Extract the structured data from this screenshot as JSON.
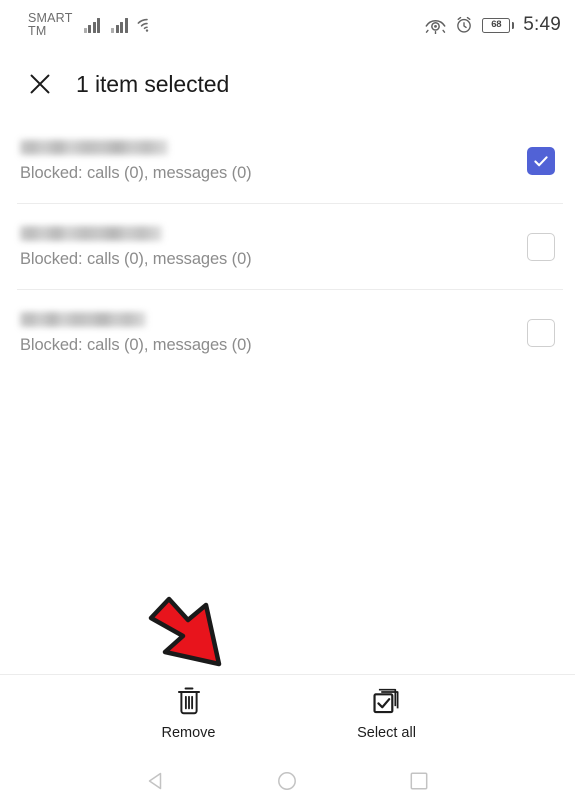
{
  "status_bar": {
    "carrier": "SMART\nTM",
    "signal_icon_1": "cellular-signal-icon",
    "signal_icon_2": "cellular-signal-icon",
    "wifi_icon": "wifi-icon",
    "eye_icon": "eye-comfort-icon",
    "alarm_icon": "alarm-clock-icon",
    "battery_level": "68",
    "time": "5:49"
  },
  "app_bar": {
    "close_icon": "close-icon",
    "title": "1 item selected"
  },
  "list": {
    "rows": [
      {
        "number": "",
        "number_redacted": true,
        "number_width": 148,
        "subtitle": "Blocked: calls (0), messages (0)",
        "checked": true
      },
      {
        "number": "",
        "number_redacted": true,
        "number_width": 142,
        "subtitle": "Blocked: calls (0), messages (0)",
        "checked": false
      },
      {
        "number": "",
        "number_redacted": true,
        "number_width": 126,
        "subtitle": "Blocked: calls (0), messages (0)",
        "checked": false
      }
    ]
  },
  "annotation": {
    "arrow": "red-arrow-pointing-down-right",
    "arrow_color": "#E8141C",
    "arrow_outline_color": "#1a1a1a"
  },
  "toolbar": {
    "remove": {
      "icon": "trash-icon",
      "label": "Remove"
    },
    "select_all": {
      "icon": "select-all-icon",
      "label": "Select all"
    }
  },
  "nav_bar": {
    "back": "back-triangle-icon",
    "home": "home-circle-icon",
    "recents": "recents-square-icon"
  },
  "colors": {
    "accent": "#5162d6",
    "divider": "#ececec",
    "subtitle": "#8c8c8c",
    "title": "#1b1b1b"
  }
}
